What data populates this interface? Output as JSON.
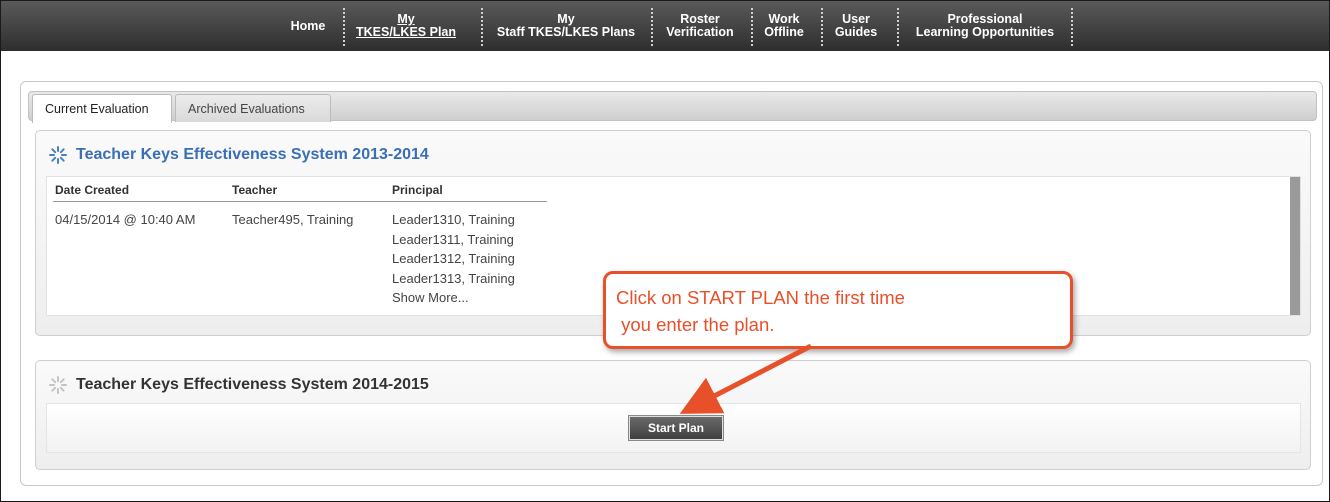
{
  "nav": {
    "items": [
      {
        "label": "Home"
      },
      {
        "label": "My\nTKES/LKES Plan",
        "active": true
      },
      {
        "label": "My\nStaff TKES/LKES Plans"
      },
      {
        "label": "Roster\nVerification"
      },
      {
        "label": "Work\nOffline"
      },
      {
        "label": "User\nGuides"
      },
      {
        "label": "Professional\nLearning Opportunities"
      }
    ]
  },
  "tabs": {
    "current": "Current Evaluation",
    "archived": "Archived Evaluations"
  },
  "evaluation_2013": {
    "title": "Teacher Keys Effectiveness System 2013-2014",
    "headers": {
      "date": "Date Created",
      "teacher": "Teacher",
      "principal": "Principal"
    },
    "row": {
      "date": "04/15/2014 @ 10:40 AM",
      "teacher": "Teacher495, Training",
      "principals": [
        "Leader1310, Training",
        "Leader1311, Training",
        "Leader1312, Training",
        "Leader1313, Training"
      ],
      "show_more": "Show More..."
    }
  },
  "evaluation_2014": {
    "title": "Teacher Keys Effectiveness System 2014-2015",
    "start_button": "Start Plan"
  },
  "callout": {
    "text": "Click on START PLAN the first time\n you enter the plan.",
    "color": "#e8502a"
  },
  "colors": {
    "link_blue": "#3a6eb5",
    "nav_dark": "#2e2e2e"
  }
}
